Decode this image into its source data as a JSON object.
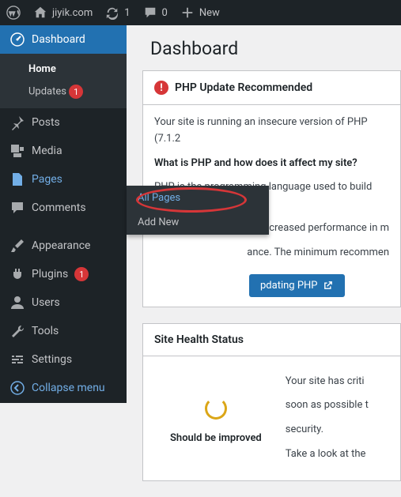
{
  "toolbar": {
    "site_name": "jiyik.com",
    "refresh_count": "1",
    "comments_count": "0",
    "new_label": "New"
  },
  "sidebar": {
    "dashboard": {
      "label": "Dashboard"
    },
    "dashboard_sub": {
      "home": "Home",
      "updates": "Updates",
      "updates_count": "1"
    },
    "posts": {
      "label": "Posts"
    },
    "media": {
      "label": "Media"
    },
    "pages": {
      "label": "Pages"
    },
    "comments": {
      "label": "Comments"
    },
    "appearance": {
      "label": "Appearance"
    },
    "plugins": {
      "label": "Plugins",
      "count": "1"
    },
    "users": {
      "label": "Users"
    },
    "tools": {
      "label": "Tools"
    },
    "settings": {
      "label": "Settings"
    },
    "collapse": {
      "label": "Collapse menu"
    }
  },
  "flyout": {
    "all_pages": "All Pages",
    "add_new": "Add New"
  },
  "content": {
    "title": "Dashboard",
    "php": {
      "heading": "PHP Update Recommended",
      "line1": "Your site is running an insecure version of PHP (7.1.2",
      "line2_strong": "What is PHP and how does it affect my site?",
      "line3": "PHP is the programming language used to build and",
      "line3b": "th increased performance in m",
      "line3c": "ance. The minimum recommen",
      "button": "pdating PHP"
    },
    "health": {
      "heading": "Site Health Status",
      "status_label": "Should be improved",
      "text1": "Your site has criti",
      "text2": "soon as possible t",
      "text3": "security.",
      "text4": "Take a look at the"
    }
  }
}
